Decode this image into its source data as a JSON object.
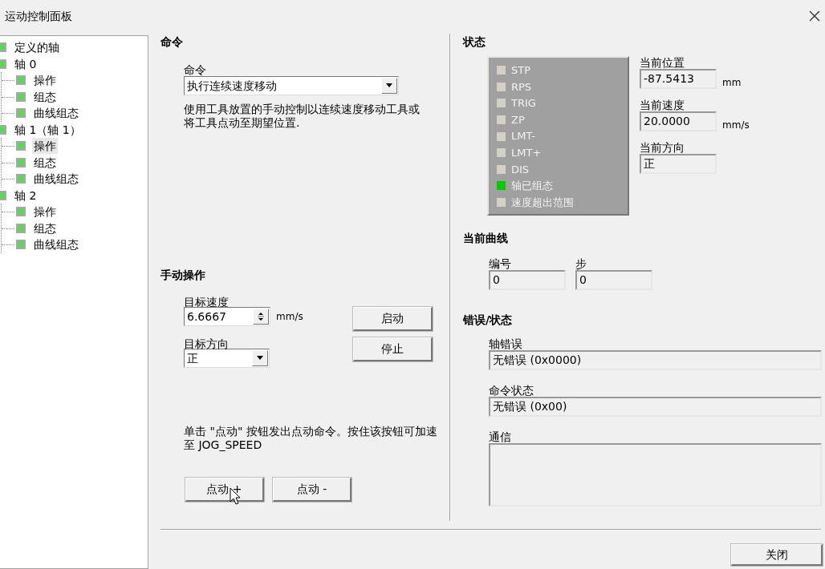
{
  "window": {
    "title": "运动控制面板"
  },
  "tree": [
    {
      "label": "定义的轴",
      "selected": false
    },
    {
      "label": "轴 0",
      "selected": false,
      "children": [
        {
          "label": "操作",
          "selected": false
        },
        {
          "label": "组态",
          "selected": false
        },
        {
          "label": "曲线组态",
          "selected": false
        }
      ]
    },
    {
      "label": "轴 1（轴 1）",
      "selected": false,
      "children": [
        {
          "label": "操作",
          "selected": true
        },
        {
          "label": "组态",
          "selected": false
        },
        {
          "label": "曲线组态",
          "selected": false
        }
      ]
    },
    {
      "label": "轴 2",
      "selected": false,
      "children": [
        {
          "label": "操作",
          "selected": false
        },
        {
          "label": "组态",
          "selected": false
        },
        {
          "label": "曲线组态",
          "selected": false
        }
      ]
    }
  ],
  "command": {
    "heading": "命令",
    "label": "命令",
    "value": "执行连续速度移动",
    "description": "使用工具放置的手动控制以连续速度移动工具或将工具点动至期望位置."
  },
  "manual": {
    "heading": "手动操作",
    "speed_label": "目标速度",
    "speed_value": "6.6667",
    "speed_unit": "mm/s",
    "direction_label": "目标方向",
    "direction_value": "正",
    "start_button": "启动",
    "stop_button": "停止",
    "note": "单击 \"点动\" 按钮发出点动命令。按住该按钮可加速至 JOG_SPEED",
    "jog_buttons": [
      "点动 +",
      "点动 -"
    ]
  },
  "status": {
    "heading": "状态",
    "indicators": [
      {
        "label": "STP",
        "on": false
      },
      {
        "label": "RPS",
        "on": false
      },
      {
        "label": "TRIG",
        "on": false
      },
      {
        "label": "ZP",
        "on": false
      },
      {
        "label": "LMT-",
        "on": false
      },
      {
        "label": "LMT+",
        "on": false
      },
      {
        "label": "DIS",
        "on": false
      },
      {
        "label": "轴已组态",
        "on": true
      },
      {
        "label": "速度超出范围",
        "on": false
      }
    ],
    "fields": [
      {
        "label": "当前位置",
        "value": "-87.5413",
        "unit": "mm"
      },
      {
        "label": "当前速度",
        "value": "20.0000",
        "unit": "mm/s"
      },
      {
        "label": "当前方向",
        "value": "正"
      }
    ]
  },
  "curve": {
    "heading": "当前曲线",
    "fields": [
      {
        "label": "编号",
        "value": "0"
      },
      {
        "label": "步",
        "value": "0"
      }
    ]
  },
  "errors": {
    "heading": "错误/状态",
    "fields": [
      {
        "label": "轴错误",
        "value": "无错误 (0x0000)",
        "kind": "line"
      },
      {
        "label": "命令状态",
        "value": "无错误 (0x00)",
        "kind": "line"
      },
      {
        "label": "通信",
        "kind": "area"
      }
    ]
  },
  "close_button": "关闭"
}
